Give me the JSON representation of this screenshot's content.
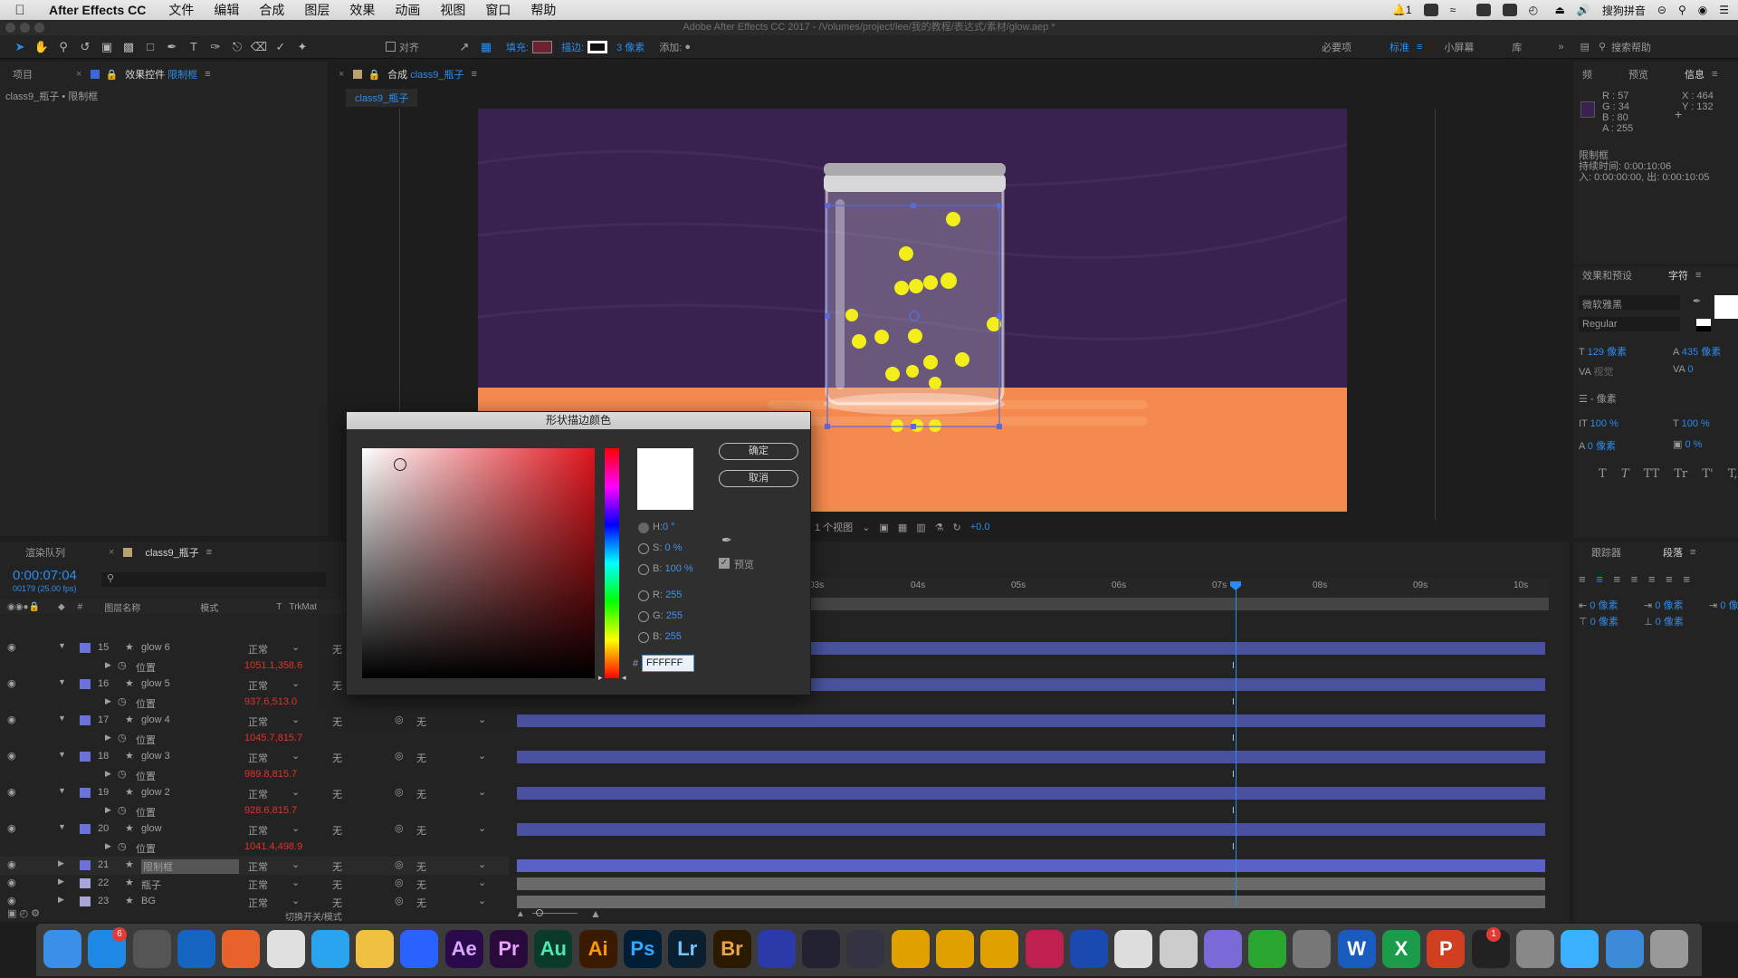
{
  "menubar": {
    "app": "After Effects CC",
    "items": [
      "文件",
      "编辑",
      "合成",
      "图层",
      "效果",
      "动画",
      "视图",
      "窗口",
      "帮助"
    ],
    "notif_count": "1",
    "input_method": "搜狗拼音"
  },
  "window": {
    "title": "Adobe After Effects CC 2017 - /Volumes/project/lee/我的教程/表达式/素材/glow.aep *"
  },
  "toolbar": {
    "align_label": "对齐",
    "fill_label": "填充:",
    "stroke_label": "描边:",
    "stroke_width": "3 像素",
    "add_label": "添加:",
    "workspaces": [
      "必要项",
      "标准",
      "小屏幕",
      "库"
    ],
    "active_workspace": "标准",
    "search_placeholder": "搜索帮助"
  },
  "left_panel": {
    "tab_project": "项目",
    "tab_effects_prefix": "效果控件",
    "tab_effects_layer": "限制框",
    "breadcrumb": "class9_瓶子 • 限制框"
  },
  "comp_panel": {
    "tab_prefix": "合成",
    "tab_name": "class9_瓶子",
    "subtab": "class9_瓶子",
    "views": "1 个视图",
    "exposure": "+0.0"
  },
  "color_dialog": {
    "title": "形状描边颜色",
    "ok": "确定",
    "cancel": "取消",
    "h_label": "H:",
    "h_value": "0 °",
    "s_label": "S:",
    "s_value": "0 %",
    "b_label": "B:",
    "b_value": "100 %",
    "r_label": "R:",
    "r_value": "255",
    "g_label": "G:",
    "g_value": "255",
    "b2_label": "B:",
    "b2_value": "255",
    "hex_prefix": "#",
    "hex_value": "FFFFFF",
    "preview_label": "预览",
    "preview_checked": true,
    "swatch_color": "#FFFFFF"
  },
  "info_panel": {
    "tabs": [
      "频",
      "预览",
      "信息"
    ],
    "r": "R : 57",
    "g": "G : 34",
    "b": "B : 80",
    "a": "A : 255",
    "x": "X : 464",
    "y": "Y : 132",
    "layer": "限制框",
    "duration": "持续时间: 0:00:10:06",
    "inout": "入: 0:00:00:00, 出: 0:00:10:05",
    "sample_color": "#392250"
  },
  "char_panel": {
    "tabs": [
      "效果和预设",
      "字符"
    ],
    "font": "微软雅黑",
    "style": "Regular",
    "size": "129 像素",
    "leading": "435 像素",
    "kerning": "视觉",
    "tracking": "0",
    "stroke": "- 像素",
    "vscale": "100 %",
    "hscale": "100 %",
    "baseline": "0 像素",
    "tsume": "0 %",
    "styles": [
      "T",
      "T",
      "TT",
      "Tr",
      "T'",
      "T,"
    ]
  },
  "para_panel": {
    "tabs": [
      "跟踪器",
      "段落"
    ],
    "indent_left": "0 像素",
    "indent_first": "0 像素",
    "indent_right": "0 像素",
    "space_before": "0 像素",
    "space_after": "0 像素"
  },
  "timeline": {
    "tab_render": "渲染队列",
    "tab_comp": "class9_瓶子",
    "timecode": "0:00:07:04",
    "frame_info": "00179 (25.00 fps)",
    "col_hash": "#",
    "col_name": "图层名称",
    "col_mode": "模式",
    "col_t": "T",
    "col_trk": "TrkMat",
    "ruler": [
      "03s",
      "04s",
      "05s",
      "06s",
      "07s",
      "08s",
      "09s",
      "10s"
    ],
    "footer_toggle": "切换开关/模式",
    "layers": [
      {
        "num": "15",
        "name": "glow 6",
        "mode": "正常",
        "trk": "无",
        "prop": "位置",
        "value": "1051.1,358.6",
        "color": "#6b72d8"
      },
      {
        "num": "16",
        "name": "glow 5",
        "mode": "正常",
        "trk": "无",
        "prop": "位置",
        "value": "937.6,513.0",
        "color": "#6b72d8"
      },
      {
        "num": "17",
        "name": "glow 4",
        "mode": "正常",
        "trk": "无",
        "parent": "无",
        "prop": "位置",
        "value": "1045.7,815.7",
        "color": "#6b72d8"
      },
      {
        "num": "18",
        "name": "glow 3",
        "mode": "正常",
        "trk": "无",
        "parent": "无",
        "prop": "位置",
        "value": "989.8,815.7",
        "color": "#6b72d8"
      },
      {
        "num": "19",
        "name": "glow 2",
        "mode": "正常",
        "trk": "无",
        "parent": "无",
        "prop": "位置",
        "value": "928.6,815.7",
        "color": "#6b72d8"
      },
      {
        "num": "20",
        "name": "glow",
        "mode": "正常",
        "trk": "无",
        "parent": "无",
        "prop": "位置",
        "value": "1041.4,498.9",
        "color": "#6b72d8"
      },
      {
        "num": "21",
        "name": "限制框",
        "mode": "正常",
        "trk": "无",
        "parent": "无",
        "color": "#6b72d8"
      },
      {
        "num": "22",
        "name": "瓶子",
        "mode": "正常",
        "trk": "无",
        "parent": "无",
        "color": "#a6a6d8"
      },
      {
        "num": "23",
        "name": "BG",
        "mode": "正常",
        "trk": "无",
        "parent": "无",
        "color": "#a6a6d8"
      }
    ]
  },
  "dock": {
    "apps": [
      "Finder",
      "App Store",
      "Launchpad",
      "Safari",
      "Firefox",
      "Chrome",
      "QQ浏览器",
      "Photos",
      "Baidu",
      "Ae",
      "Pr",
      "Au",
      "Ai",
      "Ps",
      "Lr",
      "Br",
      "Tools",
      "Motion",
      "Compressor",
      "Hand",
      "Nuke",
      "NukeX",
      "DaVinci",
      "Weather",
      "Cinema",
      "Preview",
      "Colors",
      "WeChat",
      "System",
      "Word",
      "Excel",
      "PowerPoint",
      "QQ",
      "Network",
      "Mail",
      "Photos2",
      "Trash"
    ],
    "badge_appstore": "6",
    "badge_qq": "1"
  }
}
